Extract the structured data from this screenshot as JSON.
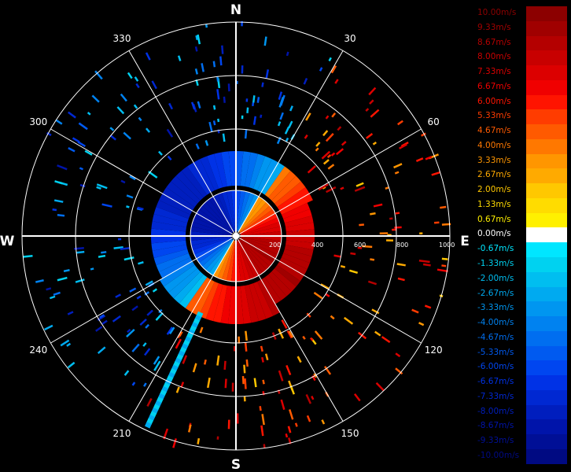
{
  "radar": {
    "cardinals": {
      "north": "N",
      "east": "E",
      "south": "S",
      "west": "W"
    },
    "azimuth_labels": [
      {
        "angle": 30,
        "label": "30"
      },
      {
        "angle": 60,
        "label": "60"
      },
      {
        "angle": 120,
        "label": "120"
      },
      {
        "angle": 150,
        "label": "150"
      },
      {
        "angle": 210,
        "label": "210"
      },
      {
        "angle": 240,
        "label": "240"
      },
      {
        "angle": 300,
        "label": "300"
      },
      {
        "angle": 330,
        "label": "330"
      }
    ],
    "range_labels": [
      "200",
      "400",
      "600",
      "800",
      "1000"
    ]
  },
  "legend": {
    "items": [
      {
        "label": "10.00m/s",
        "color": "#8c0000",
        "text_color": "#8c0000"
      },
      {
        "label": "9.33m/s",
        "color": "#a00000",
        "text_color": "#a00000"
      },
      {
        "label": "8.67m/s",
        "color": "#b40000",
        "text_color": "#b40000"
      },
      {
        "label": "8.00m/s",
        "color": "#c80000",
        "text_color": "#c80000"
      },
      {
        "label": "7.33m/s",
        "color": "#dc0000",
        "text_color": "#dc0000"
      },
      {
        "label": "6.67m/s",
        "color": "#f00000",
        "text_color": "#f00000"
      },
      {
        "label": "6.00m/s",
        "color": "#ff1400",
        "text_color": "#ff1400"
      },
      {
        "label": "5.33m/s",
        "color": "#ff3c00",
        "text_color": "#ff3c00"
      },
      {
        "label": "4.67m/s",
        "color": "#ff5a00",
        "text_color": "#ff5a00"
      },
      {
        "label": "4.00m/s",
        "color": "#ff7800",
        "text_color": "#ff7800"
      },
      {
        "label": "3.33m/s",
        "color": "#ff9600",
        "text_color": "#ff9600"
      },
      {
        "label": "2.67m/s",
        "color": "#ffaa00",
        "text_color": "#ffaa00"
      },
      {
        "label": "2.00m/s",
        "color": "#ffc800",
        "text_color": "#ffc800"
      },
      {
        "label": "1.33m/s",
        "color": "#ffdc00",
        "text_color": "#ffdc00"
      },
      {
        "label": "0.67m/s",
        "color": "#fff000",
        "text_color": "#fff000"
      },
      {
        "label": "0.00m/s",
        "color": "#ffffff",
        "text_color": "#ffffff"
      },
      {
        "label": "-0.67m/s",
        "color": "#00e6ff",
        "text_color": "#00e6ff"
      },
      {
        "label": "-1.33m/s",
        "color": "#00d2f0",
        "text_color": "#00d2f0"
      },
      {
        "label": "-2.00m/s",
        "color": "#00bef0",
        "text_color": "#00bef0"
      },
      {
        "label": "-2.67m/s",
        "color": "#00aaf0",
        "text_color": "#00aaf0"
      },
      {
        "label": "-3.33m/s",
        "color": "#0096f0",
        "text_color": "#0096f0"
      },
      {
        "label": "-4.00m/s",
        "color": "#0082f0",
        "text_color": "#0082f0"
      },
      {
        "label": "-4.67m/s",
        "color": "#006ef0",
        "text_color": "#006ef0"
      },
      {
        "label": "-5.33m/s",
        "color": "#005af0",
        "text_color": "#005af0"
      },
      {
        "label": "-6.00m/s",
        "color": "#0046f0",
        "text_color": "#0046f0"
      },
      {
        "label": "-6.67m/s",
        "color": "#0032e6",
        "text_color": "#0032e6"
      },
      {
        "label": "-7.33m/s",
        "color": "#0028d2",
        "text_color": "#0028d2"
      },
      {
        "label": "-8.00m/s",
        "color": "#001ebe",
        "text_color": "#001ebe"
      },
      {
        "label": "-8.67m/s",
        "color": "#0014aa",
        "text_color": "#0014aa"
      },
      {
        "label": "-9.33m/s",
        "color": "#000f96",
        "text_color": "#000f96"
      },
      {
        "label": "-10.00m/s",
        "color": "#000a82",
        "text_color": "#000a82"
      }
    ]
  }
}
